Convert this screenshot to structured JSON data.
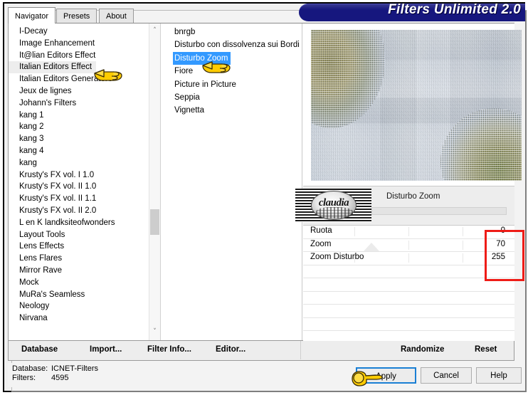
{
  "window": {
    "title": "Filters Unlimited 2.0"
  },
  "tabs": [
    {
      "label": "Navigator",
      "active": true
    },
    {
      "label": "Presets",
      "active": false
    },
    {
      "label": "About",
      "active": false
    }
  ],
  "categories": {
    "selected": "Italian Editors Effect",
    "items": [
      "I-Decay",
      "Image Enhancement",
      "It@lian Editors Effect",
      "Italian Editors Effect",
      "Italian Editors Generatore",
      "Jeux de lignes",
      "Johann's Filters",
      "kang 1",
      "kang 2",
      "kang 3",
      "kang 4",
      "kang",
      "Krusty's FX vol. I 1.0",
      "Krusty's FX vol. II 1.0",
      "Krusty's FX vol. II 1.1",
      "Krusty's FX vol. II 2.0",
      "L en K landksiteofwonders",
      "Layout Tools",
      "Lens Effects",
      "Lens Flares",
      "Mirror Rave",
      "Mock",
      "MuRa's Seamless",
      "Neology",
      "Nirvana"
    ]
  },
  "filters": {
    "selected": "Disturbo Zoom",
    "items": [
      "bnrgb",
      "Disturbo con dissolvenza sui Bordi",
      "Disturbo Zoom",
      "Fiore",
      "Picture in Picture",
      "Seppia",
      "Vignetta"
    ]
  },
  "filter_header": {
    "brand": "claudia",
    "name": "Disturbo Zoom"
  },
  "parameters": [
    {
      "name": "Ruota",
      "value": "0"
    },
    {
      "name": "Zoom",
      "value": "70"
    },
    {
      "name": "Zoom Disturbo",
      "value": "255"
    }
  ],
  "action_bar": {
    "database": "Database",
    "import": "Import...",
    "filter_info": "Filter Info...",
    "editor": "Editor...",
    "randomize": "Randomize",
    "reset": "Reset"
  },
  "status": {
    "database_label": "Database:",
    "database_value": "ICNET-Filters",
    "filters_label": "Filters:",
    "filters_value": "4595"
  },
  "dialog_buttons": {
    "apply": "Apply",
    "cancel": "Cancel",
    "help": "Help"
  },
  "colors": {
    "title_bar": "#16177e",
    "selection_blue": "#3399ff",
    "highlight_red": "#ee1c17",
    "focus_blue": "#1a7fd4",
    "cursor_yellow": "#ffcc00"
  },
  "icons": {
    "scroll_up": "˄",
    "scroll_down": "˅"
  }
}
